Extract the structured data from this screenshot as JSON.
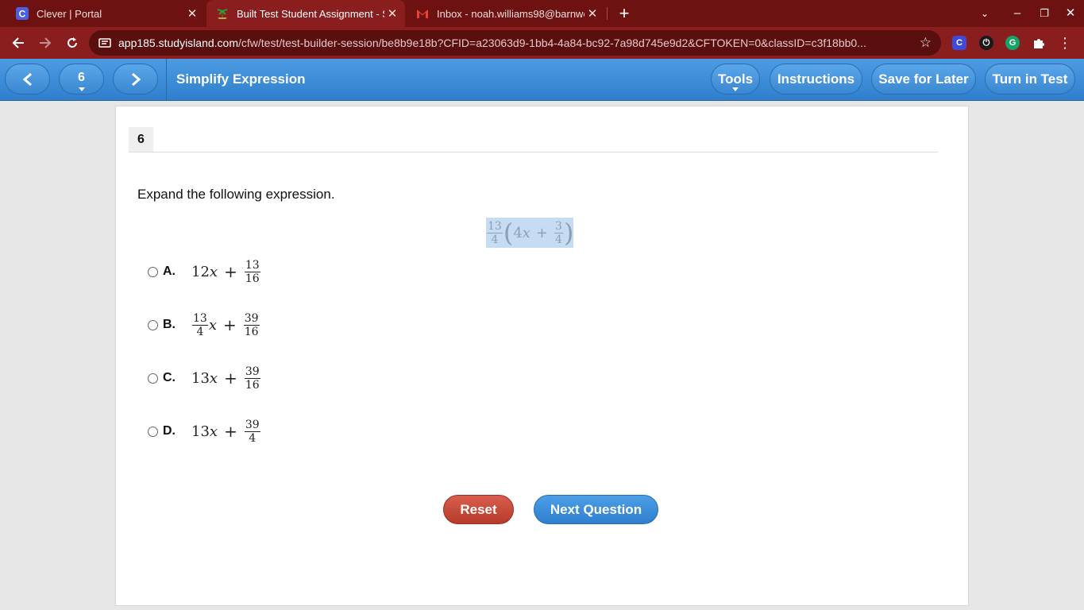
{
  "browser": {
    "tabs": [
      {
        "title": "Clever | Portal",
        "favicon": "clever-icon",
        "active": false
      },
      {
        "title": "Built Test Student Assignment - S",
        "favicon": "studyisland-icon",
        "active": true
      },
      {
        "title": "Inbox - noah.williams98@barnwe",
        "favicon": "gmail-icon",
        "active": false
      }
    ],
    "url_host": "app185.studyisland.com",
    "url_path": "/cfw/test/test-builder-session/be8b9e18b?CFID=a23063d9-1bb4-4a84-bc92-7a98d745e9d2&CFTOKEN=0&classID=c3f18bb0...",
    "extensions": [
      "C",
      "⏻",
      "G"
    ],
    "colors": {
      "chrome": "#8a1d1d",
      "tabstrip": "#6e1111"
    }
  },
  "header": {
    "question_number": "6",
    "title": "Simplify Expression",
    "buttons": {
      "tools": "Tools",
      "instructions": "Instructions",
      "save": "Save for Later",
      "turn_in": "Turn in Test"
    },
    "color": "#3a87d2"
  },
  "question": {
    "number": "6",
    "prompt": "Expand the following expression.",
    "expression": {
      "coef_num": "13",
      "coef_den": "4",
      "term": "4",
      "var": "x",
      "plus": "+",
      "const_num": "3",
      "const_den": "4",
      "lparen": "(",
      "rparen": ")"
    },
    "choices": [
      {
        "letter": "A.",
        "coef": "12",
        "var": "x",
        "plus": "+",
        "num": "13",
        "den": "16"
      },
      {
        "letter": "B.",
        "coef_num": "13",
        "coef_den": "4",
        "var": "x",
        "plus": "+",
        "num": "39",
        "den": "16"
      },
      {
        "letter": "C.",
        "coef": "13",
        "var": "x",
        "plus": "+",
        "num": "39",
        "den": "16"
      },
      {
        "letter": "D.",
        "coef": "13",
        "var": "x",
        "plus": "+",
        "num": "39",
        "den": "4"
      }
    ]
  },
  "actions": {
    "reset": "Reset",
    "next": "Next Question",
    "reset_color": "#c0402f",
    "next_color": "#3a87d2"
  }
}
